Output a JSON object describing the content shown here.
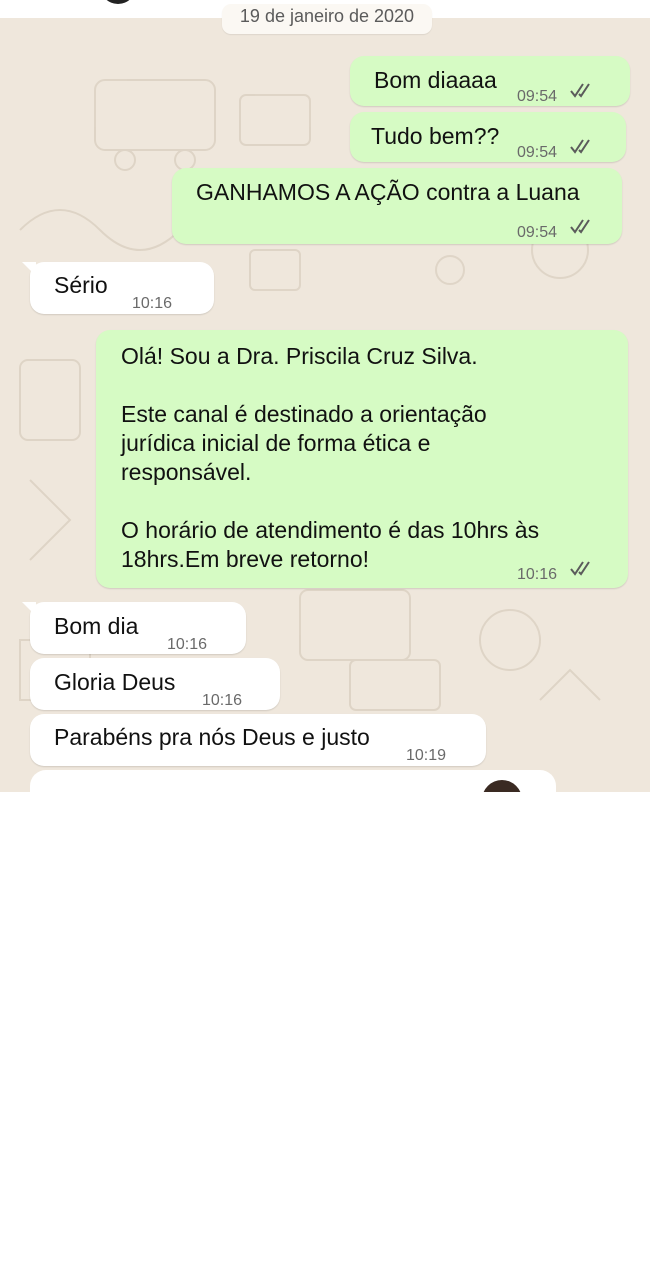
{
  "chat": {
    "date_chip": "19 de janeiro de 2020",
    "messages": [
      {
        "text": "Bom diaaaa",
        "time": "09:54"
      },
      {
        "text": "Tudo bem??",
        "time": "09:54"
      },
      {
        "text": "GANHAMOS A AÇÃO contra a Luana",
        "time": "09:54"
      },
      {
        "text": "Sério",
        "time": "10:16"
      },
      {
        "text": "Olá! Sou a Dra. Priscila Cruz Silva.\n\nEste canal é destinado a orientação\njurídica inicial de forma ética e\nresponsável.\n\nO horário de atendimento é das 10hrs às\n18hrs.Em breve retorno!",
        "time": "10:16"
      },
      {
        "text": "Bom dia",
        "time": "10:16"
      },
      {
        "text": "Gloria Deus",
        "time": "10:16"
      },
      {
        "text": "Parabéns pra nós Deus e justo",
        "time": "10:19"
      }
    ]
  },
  "colors": {
    "outgoing_bubble": "#d6fbc4",
    "incoming_bubble": "#ffffff",
    "wallpaper": "#efe7dc",
    "read_ticks": "#5b5b5b"
  },
  "icons": {
    "read_receipt": "double-check-icon"
  }
}
